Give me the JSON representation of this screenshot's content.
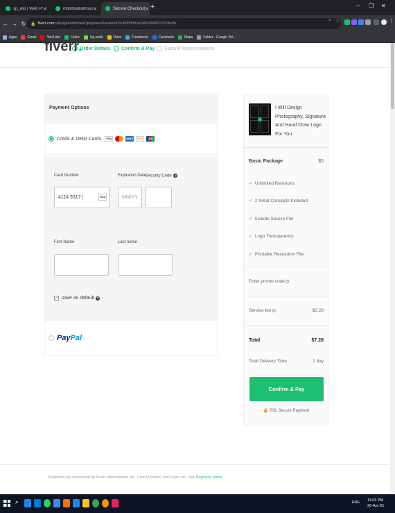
{
  "browser": {
    "tabs": [
      {
        "label": "sp_ikki | Web Programming & J",
        "active": false
      },
      {
        "label": "mdimtiaduilhossai | Logo Design",
        "active": false
      },
      {
        "label": "Secure Checkout",
        "active": true
      }
    ],
    "url_domain": "fiverr.com",
    "url_path": "/v4/payments/new?paymentSessionID=c60f9f38ca2d0549860176c8e0b",
    "bookmarks": [
      {
        "label": "Apps",
        "color": "#8ab4f8"
      },
      {
        "label": "Gmail",
        "color": "#ea4335"
      },
      {
        "label": "YouTube",
        "color": "#ff0000"
      },
      {
        "label": "Fiverr",
        "color": "#1dbf73"
      },
      {
        "label": "Up-work",
        "color": "#6fda44"
      },
      {
        "label": "Drive",
        "color": "#fbbc04"
      },
      {
        "label": "Freelancer",
        "color": "#29b2fe"
      },
      {
        "label": "Facebook",
        "color": "#1877f2"
      },
      {
        "label": "Maps",
        "color": "#34a853"
      },
      {
        "label": "Folder - Google Dri...",
        "color": "#9aa0a6"
      }
    ]
  },
  "site": {
    "logo_text": "fiverr",
    "logo_dot": ".",
    "steps": [
      "Order Details",
      "Confirm & Pay",
      "Submit Requirements"
    ]
  },
  "payment": {
    "heading": "Payment Options",
    "credit_label": "Credit & Debit Cards",
    "card_brands": [
      "VISA",
      "MC",
      "AMEX",
      "DISC",
      "JCB"
    ],
    "card_number_label": "Card Number",
    "card_number_value": "4114 9317",
    "card_type_badge": "VISA",
    "expiration_label": "Expiration Date",
    "expiration_placeholder": "MM/YY",
    "security_label": "Security Code",
    "first_name_label": "First Name",
    "last_name_label": "Last name",
    "save_default_label": "save as default",
    "save_default_checked": true,
    "paypal_pay": "Pay",
    "paypal_pal": "Pal"
  },
  "summary": {
    "gig_title": "I Will Design Photography, Signature And Hand Draw Logo For You",
    "package_name": "Basic Package",
    "package_price": "$5",
    "features": [
      "Unlimited Revisions",
      "2 Initial Concepts Included",
      "Include Source File",
      "Logo Transparency",
      "Printable Resolution File"
    ],
    "promo_label": "Enter promo code",
    "service_fee_label": "Service fee",
    "service_fee_value": "$2.28",
    "total_label": "Total",
    "total_value": "$7.28",
    "delivery_label": "Total Delivery Time",
    "delivery_value": "1 day",
    "confirm_button": "Confirm & Pay",
    "ssl_text": "SSL Secure Payment"
  },
  "footer": {
    "text": "Payments are processed by Fiverr International Ltd., Fiverr Limited, and Fiverr Inc. See",
    "link": "Payment Terms"
  },
  "taskbar": {
    "time": "11:03 PM",
    "date": "20-Apr-21",
    "lang": "ENG"
  }
}
